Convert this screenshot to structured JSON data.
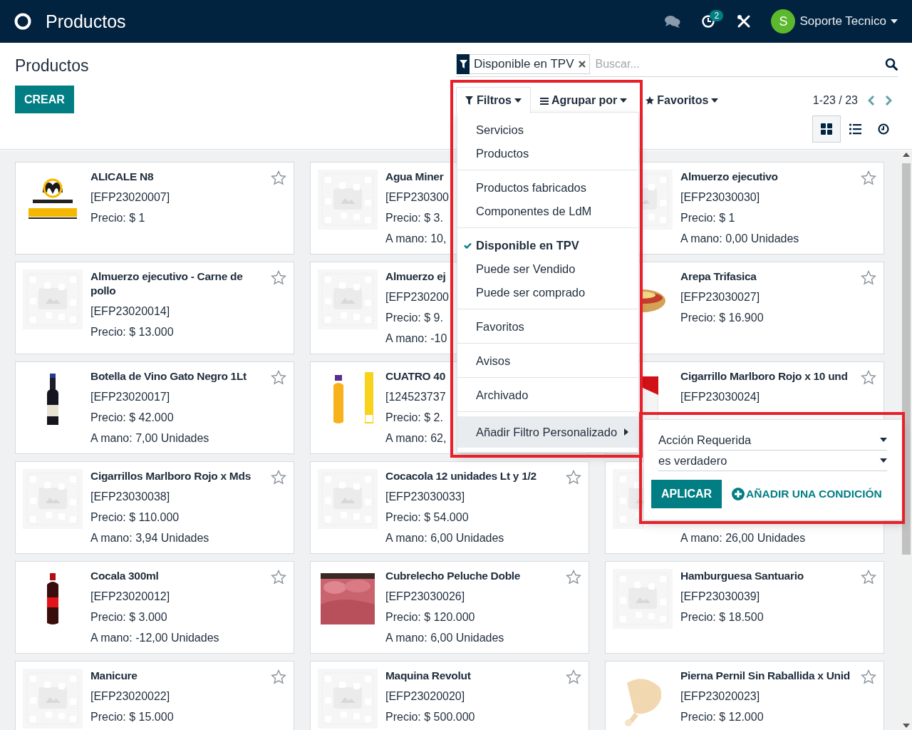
{
  "app": {
    "title": "Productos",
    "notifications": "2",
    "user": {
      "initial": "S",
      "name": "Soporte Tecnico"
    }
  },
  "breadcrumb": "Productos",
  "create_button": "CREAR",
  "search": {
    "facet": "Disponible en TPV",
    "placeholder": "Buscar..."
  },
  "search_buttons": [
    {
      "kind": "filter",
      "label": "Filtros",
      "open": true
    },
    {
      "kind": "groupby",
      "label": "Agrupar por",
      "open": false
    },
    {
      "kind": "favorites",
      "label": "Favoritos",
      "open": false
    }
  ],
  "pager": "1-23 / 23",
  "views": [
    {
      "kind": "kanban",
      "selected": true
    },
    {
      "kind": "list",
      "selected": false
    },
    {
      "kind": "activity",
      "selected": false
    }
  ],
  "filter_menu": {
    "groups": [
      [
        {
          "label": "Servicios",
          "checked": false
        },
        {
          "label": "Productos",
          "checked": false
        }
      ],
      [
        {
          "label": "Productos fabricados",
          "checked": false
        },
        {
          "label": "Componentes de LdM",
          "checked": false
        }
      ],
      [
        {
          "label": "Disponible en TPV",
          "checked": true
        },
        {
          "label": "Puede ser Vendido",
          "checked": false
        },
        {
          "label": "Puede ser comprado",
          "checked": false
        }
      ],
      [
        {
          "label": "Favoritos",
          "checked": false
        }
      ],
      [
        {
          "label": "Avisos",
          "checked": false
        }
      ],
      [
        {
          "label": "Archivado",
          "checked": false
        }
      ]
    ],
    "custom": {
      "label": "Añadir Filtro Personalizado",
      "expanded": true
    }
  },
  "custom_filter": {
    "field": "Acción Requerida",
    "operator": "es verdadero",
    "apply": "APLICAR",
    "add": "AÑADIR UNA CONDICIÓN"
  },
  "cards": [
    {
      "name": "ALICALE N8",
      "code": "[EFP23020007]",
      "price": "Precio: $ 1",
      "favorite": false
    },
    {
      "name": "Agua Miner",
      "code": "[EFP230300",
      "price": "Precio: $ 3.",
      "stock": "A mano: 10,"
    },
    {
      "name": "Almuerzo ejecutivo",
      "code": "[EFP23030030]",
      "price": "Precio: $ 1",
      "stock": "A mano: 0,00 Unidades",
      "favorite": false
    },
    {
      "name": "Almuerzo ejecutivo - Carne de pollo",
      "code": "[EFP23020014]",
      "price": "Precio: $ 13.000",
      "favorite": false
    },
    {
      "name": "Almuerzo ej",
      "code": "[EFP230200",
      "price": "Precio: $ 9.",
      "stock": "A mano: -10"
    },
    {
      "name": "Arepa Trifasica",
      "code": "[EFP23030027]",
      "price": "Precio: $ 16.900",
      "favorite": false
    },
    {
      "name": "Botella de Vino Gato Negro 1Lt",
      "code": "[EFP23020017]",
      "price": "Precio: $ 42.000",
      "stock": "A mano: 7,00 Unidades",
      "favorite": false
    },
    {
      "name": "CUATRO 40",
      "code": "[124523737",
      "price": "Precio: $ 2.",
      "stock": "A mano: 62,"
    },
    {
      "name": "Cigarrillo Marlboro Rojo x 10 und",
      "code": "[EFP23030024]",
      "favorite": false
    },
    {
      "name": "Cigarrillos Marlboro Rojo x Mds",
      "code": "[EFP23030038]",
      "price": "Precio: $ 110.000",
      "stock": "A mano: 3,94 Unidades",
      "favorite": false
    },
    {
      "name": "Cocacola 12 unidades Lt y 1/2",
      "code": "[EFP23030033]",
      "price": "Precio: $ 54.000",
      "stock": "A mano: 6,00 Unidades",
      "favorite": false
    },
    {
      "stock": "A mano: 26,00 Unidades"
    },
    {
      "name": "Cocala 300ml",
      "code": "[EFP23020012]",
      "price": "Precio: $ 3.000",
      "stock": "A mano: -12,00 Unidades",
      "favorite": false
    },
    {
      "name": "Cubrelecho Peluche Doble",
      "code": "[EFP23030026]",
      "price": "Precio: $ 120.000",
      "stock": "A mano: 6,00 Unidades",
      "favorite": false
    },
    {
      "name": "Hamburguesa Santuario",
      "code": "[EFP23030039]",
      "price": "Precio: $ 18.500",
      "favorite": false
    },
    {
      "name": "Manicure",
      "code": "[EFP23020022]",
      "price": "Precio: $ 15.000",
      "favorite": false
    },
    {
      "name": "Maquina Revolut",
      "code": "[EFP23020020]",
      "price": "Precio: $ 500.000",
      "favorite": false
    },
    {
      "name": "Pierna Pernil Sin Raballida x Unid",
      "code": "[EFP23020023]",
      "price": "Precio: $ 12.000",
      "favorite": false
    }
  ]
}
